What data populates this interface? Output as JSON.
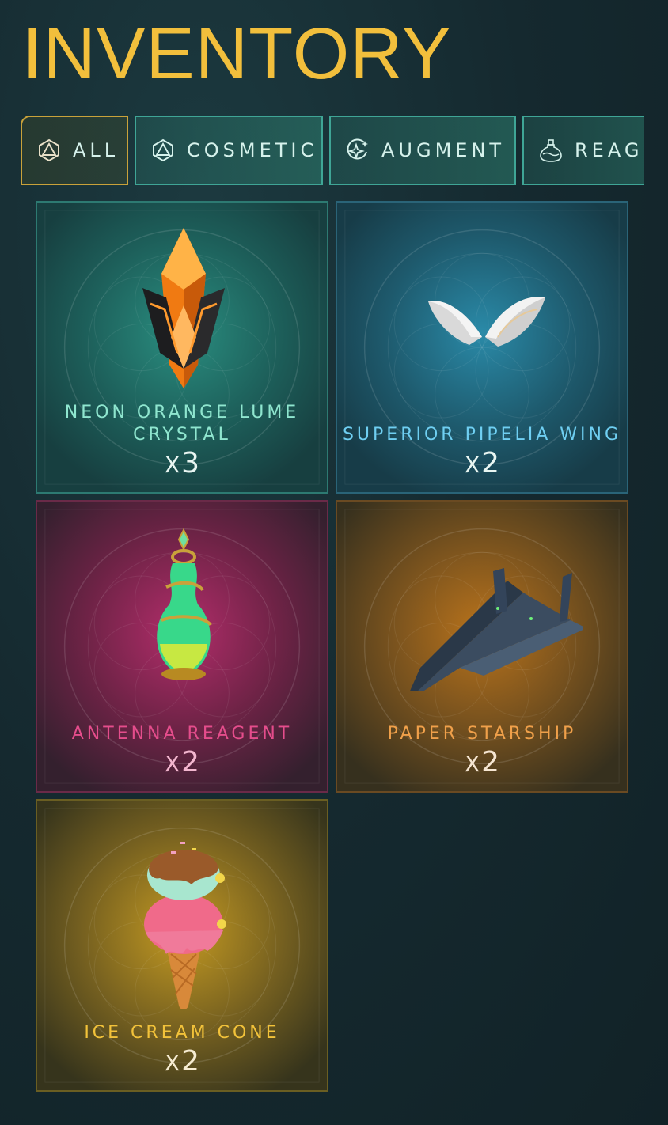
{
  "page": {
    "title": "INVENTORY"
  },
  "tabs": [
    {
      "label": "ALL",
      "icon": "d20-icon",
      "active": true
    },
    {
      "label": "COSMETIC",
      "icon": "d20-icon",
      "active": false
    },
    {
      "label": "AUGMENT",
      "icon": "sparkle-icon",
      "active": false
    },
    {
      "label": "REAG",
      "icon": "potion-icon",
      "active": false
    }
  ],
  "items": [
    {
      "name": "NEON ORANGE LUME CRYSTAL",
      "name_lines": [
        "NEON ORANGE LUME",
        "CRYSTAL"
      ],
      "qty_prefix": "X",
      "qty": "3",
      "theme": "teal",
      "name_color": "#8fe6cf",
      "icon": "crystal-icon"
    },
    {
      "name": "SUPERIOR PIPELIA WING",
      "name_lines": [
        "SUPERIOR PIPELIA WING"
      ],
      "qty_prefix": "X",
      "qty": "2",
      "theme": "blue",
      "name_color": "#6fcff2",
      "icon": "wing-icon"
    },
    {
      "name": "ANTENNA REAGENT",
      "name_lines": [
        "ANTENNA REAGENT"
      ],
      "qty_prefix": "X",
      "qty": "2",
      "theme": "pink",
      "name_color": "#e54d8c",
      "icon": "reagent-flask-icon"
    },
    {
      "name": "PAPER STARSHIP",
      "name_lines": [
        "PAPER STARSHIP"
      ],
      "qty_prefix": "X",
      "qty": "2",
      "theme": "orange",
      "name_color": "#f0a04a",
      "icon": "starship-icon"
    },
    {
      "name": "ICE CREAM CONE",
      "name_lines": [
        "ICE CREAM CONE"
      ],
      "qty_prefix": "X",
      "qty": "2",
      "theme": "yellow",
      "name_color": "#f2c23a",
      "icon": "ice-cream-icon"
    }
  ]
}
